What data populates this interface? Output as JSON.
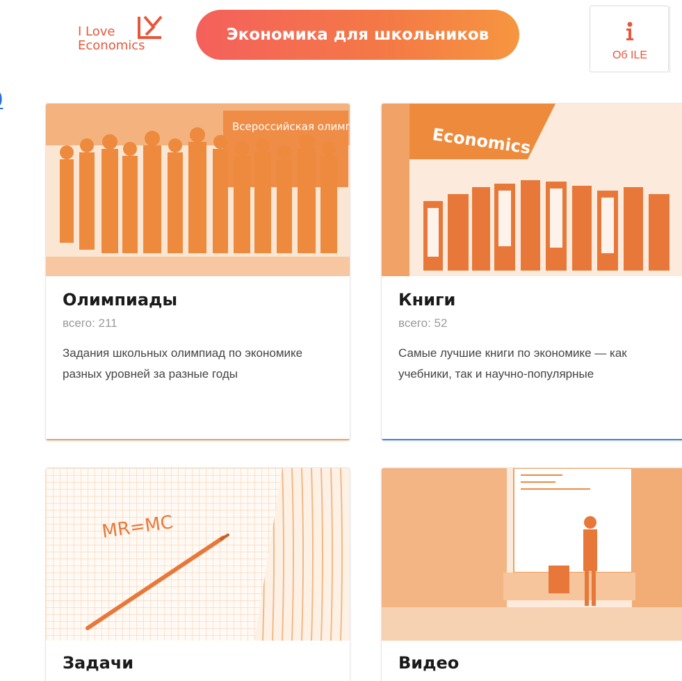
{
  "header": {
    "logo_line1": "I Love",
    "logo_line2": "Economics",
    "main_button": "Экономика для школьников",
    "about_label": "Об ILE",
    "edge_link": "o"
  },
  "colors": {
    "brand": "#e8563a",
    "pill_start": "#f4605c",
    "pill_end": "#f69640",
    "orange_accent": "#f0a060",
    "blue_accent": "#3a86d8"
  },
  "cards": [
    {
      "title": "Олимпиады",
      "count": "всего: 211",
      "description": "Задания школьных олимпиад по экономике разных уровней за разные годы",
      "banner_text": "Всероссийская олимпиада школьников"
    },
    {
      "title": "Книги",
      "count": "всего: 52",
      "description": "Самые лучшие книги по экономике — как учебники, так и научно-популярные",
      "banner_text": "Economics"
    },
    {
      "title": "Задачи",
      "formula": "MR=MC"
    },
    {
      "title": "Видео"
    }
  ]
}
